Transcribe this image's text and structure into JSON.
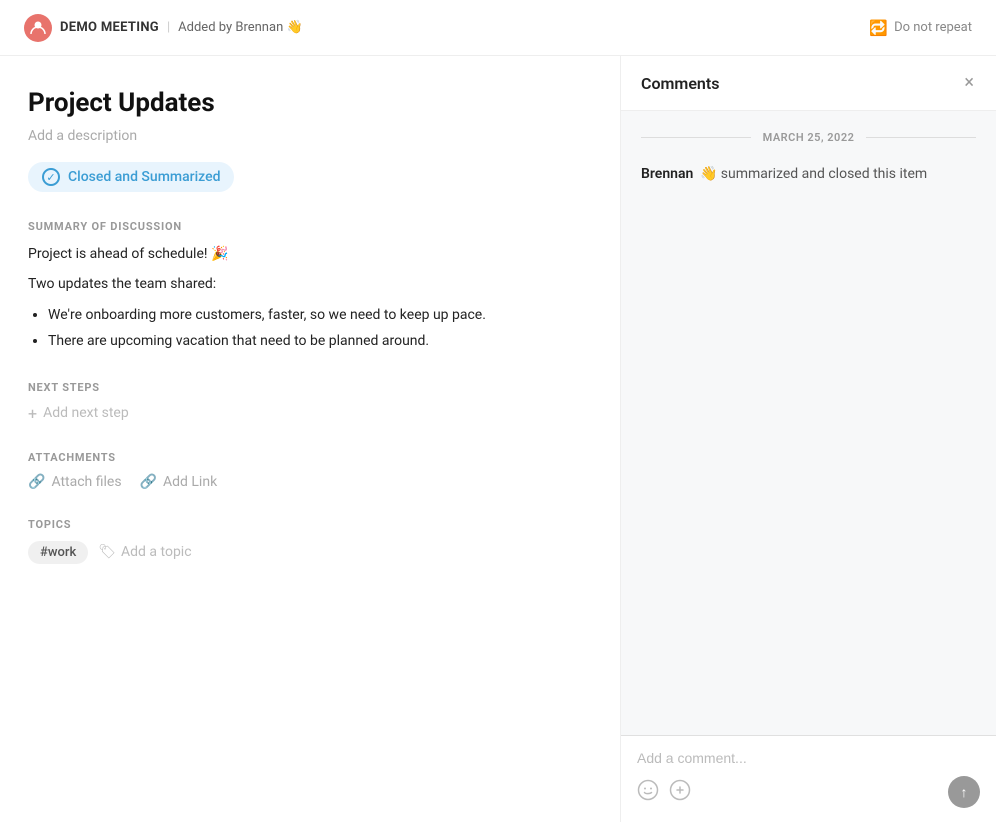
{
  "topbar": {
    "meeting_title": "DEMO MEETING",
    "separator": "|",
    "added_by": "Added by Brennan 👋",
    "repeat_label": "Do not repeat",
    "repeat_icon": "🔁"
  },
  "main": {
    "title": "Project Updates",
    "description_placeholder": "Add a description",
    "status_badge": "Closed and Summarized",
    "summary_section_label": "SUMMARY OF DISCUSSION",
    "summary_line1": "Project is ahead of schedule! 🎉",
    "summary_line2": "Two updates the team shared:",
    "summary_bullet1": "We're onboarding more customers, faster, so we need to keep up pace.",
    "summary_bullet2": "There are upcoming vacation that need to be planned around.",
    "next_steps_label": "NEXT STEPS",
    "add_next_step": "Add next step",
    "attachments_label": "ATTACHMENTS",
    "attach_files": "Attach files",
    "add_link": "Add Link",
    "topics_label": "TOPICS",
    "topic_tag": "#work",
    "add_topic": "Add a topic"
  },
  "comments": {
    "title": "Comments",
    "close_label": "×",
    "date_label": "MARCH 25, 2022",
    "comment_author": "Brennan",
    "comment_emoji": "👋",
    "comment_text": "summarized and closed this item",
    "input_placeholder": "Add a comment...",
    "emoji_icon": "😊",
    "attachment_icon": "📎",
    "send_icon": "↑"
  }
}
